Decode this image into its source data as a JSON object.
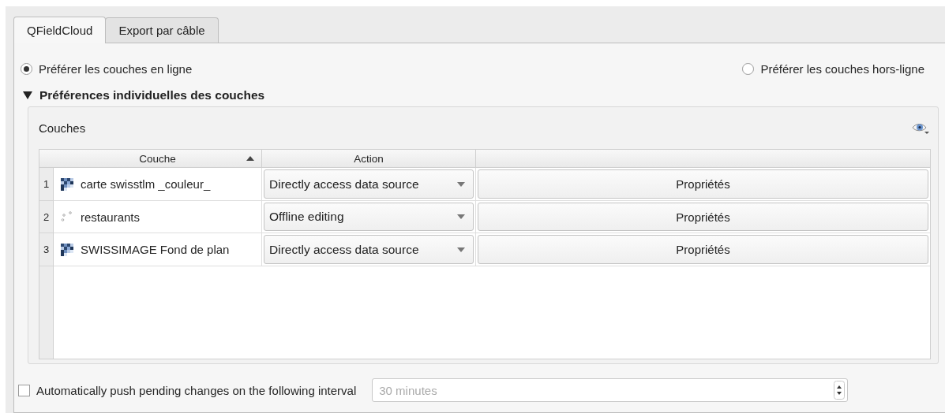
{
  "tabs": [
    {
      "label": "QFieldCloud",
      "selected": true
    },
    {
      "label": "Export par câble",
      "selected": false
    }
  ],
  "preference": [
    {
      "label": "Préférer les couches en ligne",
      "selected": true
    },
    {
      "label": "Préférer les couches hors-ligne",
      "selected": false
    }
  ],
  "section": {
    "title": "Préférences individuelles des couches",
    "expanded": true
  },
  "group": {
    "title": "Couches"
  },
  "table": {
    "columns": [
      {
        "label": "Couche",
        "sorted": true
      },
      {
        "label": "Action",
        "sorted": false
      }
    ],
    "rows": [
      {
        "number": "1",
        "layer": "carte swisstlm _couleur_",
        "kind": "raster",
        "action": "Directly access data source",
        "button": "Propriétés"
      },
      {
        "number": "2",
        "layer": "restaurants",
        "kind": "point",
        "action": "Offline editing",
        "button": "Propriétés"
      },
      {
        "number": "3",
        "layer": "SWISSIMAGE Fond de plan",
        "kind": "raster",
        "action": "Directly access data source",
        "button": "Propriétés"
      }
    ]
  },
  "autopush": {
    "label": "Automatically push pending changes on the following interval",
    "checked": false,
    "value": "30 minutes",
    "disabled": true
  }
}
